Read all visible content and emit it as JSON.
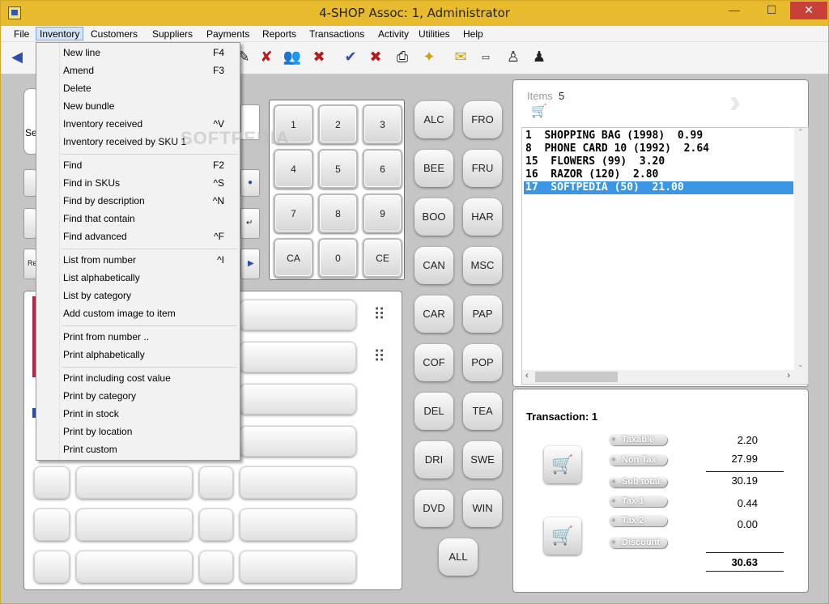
{
  "window": {
    "title": "4-SHOP   Assoc: 1, Administrator",
    "close_label": "✕"
  },
  "menu": [
    "File",
    "Inventory",
    "Customers",
    "Suppliers",
    "Payments",
    "Reports",
    "Transactions",
    "Activity",
    "Utilities",
    "Help"
  ],
  "inventory_menu": {
    "items": [
      {
        "label": "New line",
        "key": "F4"
      },
      {
        "label": "Amend",
        "key": "F3"
      },
      {
        "label": "Delete",
        "key": ""
      },
      {
        "label": "New bundle",
        "key": ""
      },
      {
        "label": "Inventory received",
        "key": "^V"
      },
      {
        "label": "Inventory received by SKU 1",
        "key": ""
      },
      {
        "label": "Find",
        "key": "F2"
      },
      {
        "label": "Find in SKUs",
        "key": "^S"
      },
      {
        "label": "Find by description",
        "key": "^N"
      },
      {
        "label": "Find that contain",
        "key": ""
      },
      {
        "label": "Find advanced",
        "key": "^F"
      },
      {
        "label": "List from number",
        "key": "^I"
      },
      {
        "label": "List alphabetically",
        "key": ""
      },
      {
        "label": "List by category",
        "key": ""
      },
      {
        "label": "Add custom image to item",
        "key": ""
      },
      {
        "label": "Print from number ..",
        "key": ""
      },
      {
        "label": "Print alphabetically",
        "key": ""
      },
      {
        "label": "Print including cost value",
        "key": ""
      },
      {
        "label": "Print by category",
        "key": ""
      },
      {
        "label": "Print in stock",
        "key": ""
      },
      {
        "label": "Print by location",
        "key": ""
      },
      {
        "label": "Print custom",
        "key": ""
      }
    ]
  },
  "keypad": [
    "1",
    "2",
    "3",
    "4",
    "5",
    "6",
    "7",
    "8",
    "9",
    "CA",
    "0",
    "CE"
  ],
  "categories": [
    "ALC",
    "FRO",
    "BEE",
    "FRU",
    "BOO",
    "HAR",
    "CAN",
    "MSC",
    "CAR",
    "PAP",
    "COF",
    "POP",
    "DEL",
    "TEA",
    "DRI",
    "SWE",
    "DVD",
    "WIN",
    "ALL"
  ],
  "left_stubs": {
    "se": "Se",
    "re": "Re"
  },
  "items": {
    "label": "Items",
    "count": "5",
    "rows": [
      "1  SHOPPING BAG (1998)  0.99",
      "8  PHONE CARD 10 (1992)  2.64",
      "15  FLOWERS (99)  3.20",
      "16  RAZOR (120)  2.80",
      "17  SOFTPEDIA (50)  21.00"
    ]
  },
  "transaction": {
    "title": "Transaction: 1",
    "labels": [
      "Taxable",
      "Non Tax",
      "Sub total",
      "Tax 1",
      "Tax 2",
      "Discount"
    ],
    "values": {
      "taxable": "2.20",
      "non_tax": "27.99",
      "sub_total": "30.19",
      "tax1": "0.44",
      "tax2": "0.00",
      "total": "30.63"
    }
  },
  "watermark": "SOFTPEDIA"
}
